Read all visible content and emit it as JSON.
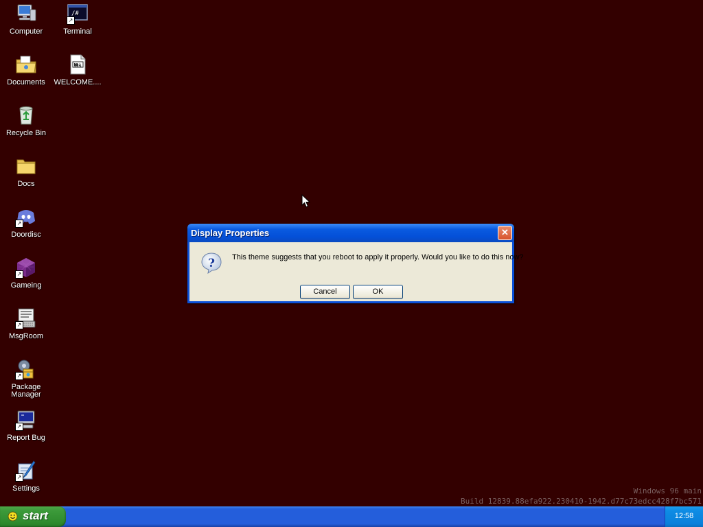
{
  "desktop": {
    "background_color": "#330000",
    "icons": [
      {
        "label": "Computer",
        "icon": "computer-icon",
        "shortcut": false
      },
      {
        "label": "Terminal",
        "icon": "terminal-icon",
        "shortcut": true
      },
      {
        "label": "Documents",
        "icon": "documents-folder-icon",
        "shortcut": false
      },
      {
        "label": "WELCOME....",
        "icon": "markdown-file-icon",
        "shortcut": false
      },
      {
        "label": "Recycle Bin",
        "icon": "recycle-bin-icon",
        "shortcut": false
      },
      {
        "label": "Docs",
        "icon": "folder-icon",
        "shortcut": false
      },
      {
        "label": "Doordisc",
        "icon": "discord-icon",
        "shortcut": true
      },
      {
        "label": "Gameing",
        "icon": "cube-icon",
        "shortcut": true
      },
      {
        "label": "MsgRoom",
        "icon": "msgroom-icon",
        "shortcut": true
      },
      {
        "label": "Package Manager",
        "icon": "package-manager-icon",
        "shortcut": true
      },
      {
        "label": "Report Bug",
        "icon": "report-bug-icon",
        "shortcut": true
      },
      {
        "label": "Settings",
        "icon": "settings-icon",
        "shortcut": true
      }
    ],
    "watermark": {
      "line1": "Windows 96 main",
      "line2": "Build 12839.88efa922.230410-1942.d77c73edcc428f7bc571"
    }
  },
  "dialog": {
    "title": "Display Properties",
    "message": "This theme suggests that you reboot to apply it properly. Would you like to do this now?",
    "icon": "question-icon",
    "cancel_label": "Cancel",
    "ok_label": "OK",
    "close_label": "✕"
  },
  "taskbar": {
    "start_label": "start",
    "clock": "12:58"
  },
  "colors": {
    "desktop": "#330000",
    "taskbar": "#245edb",
    "start_button": "#3c9a3a",
    "dialog_frame": "#0a50d8",
    "dialog_body": "#ece9d8",
    "close_button": "#d8542c"
  }
}
